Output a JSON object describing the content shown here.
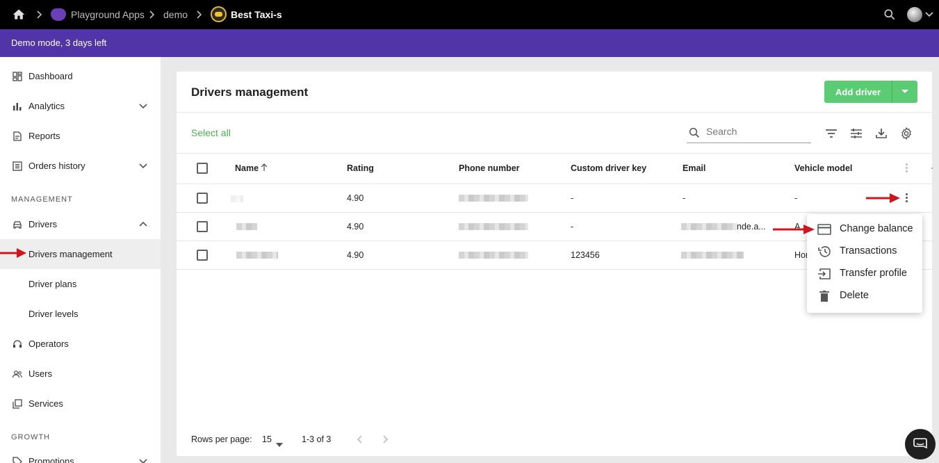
{
  "topbar": {
    "crumbs": [
      "Playground Apps",
      "demo",
      "Best Taxi-s"
    ]
  },
  "demo_banner": "Demo mode, 3 days left",
  "sidebar": {
    "items": [
      {
        "label": "Dashboard",
        "icon": "dashboard-icon"
      },
      {
        "label": "Analytics",
        "icon": "bar-chart-icon"
      },
      {
        "label": "Reports",
        "icon": "document-icon"
      },
      {
        "label": "Orders history",
        "icon": "list-icon"
      },
      {
        "label": "Drivers",
        "icon": "car-icon"
      },
      {
        "label": "Drivers management",
        "icon": ""
      },
      {
        "label": "Driver plans",
        "icon": ""
      },
      {
        "label": "Driver levels",
        "icon": ""
      },
      {
        "label": "Operators",
        "icon": "headset-icon"
      },
      {
        "label": "Users",
        "icon": "users-icon"
      },
      {
        "label": "Services",
        "icon": "services-icon"
      },
      {
        "label": "Promotions",
        "icon": "tag-icon"
      }
    ],
    "sections": [
      "MANAGEMENT",
      "GROWTH"
    ]
  },
  "main": {
    "title": "Drivers management",
    "add_button": "Add driver",
    "select_all": "Select all",
    "search_placeholder": "Search",
    "columns": [
      "Name",
      "Rating",
      "Phone number",
      "Custom driver key",
      "Email",
      "Vehicle model"
    ],
    "rows": [
      {
        "rating": "4.90",
        "custom_key": "-",
        "email": "-",
        "vehicle": "-"
      },
      {
        "rating": "4.90",
        "custom_key": "-",
        "email_suffix": "nde.a...",
        "vehicle": "A"
      },
      {
        "rating": "4.90",
        "custom_key": "123456",
        "email": "",
        "vehicle": "Hon"
      }
    ],
    "footer": {
      "rows_per_page_label": "Rows per page:",
      "rows_per_page_value": "15",
      "range": "1-3 of 3"
    }
  },
  "row_menu": {
    "items": [
      "Change balance",
      "Transactions",
      "Transfer profile",
      "Delete"
    ]
  },
  "colors": {
    "accent_green": "#5ccb74",
    "banner_purple": "#5034a8",
    "annotation_red": "#d0161b"
  }
}
